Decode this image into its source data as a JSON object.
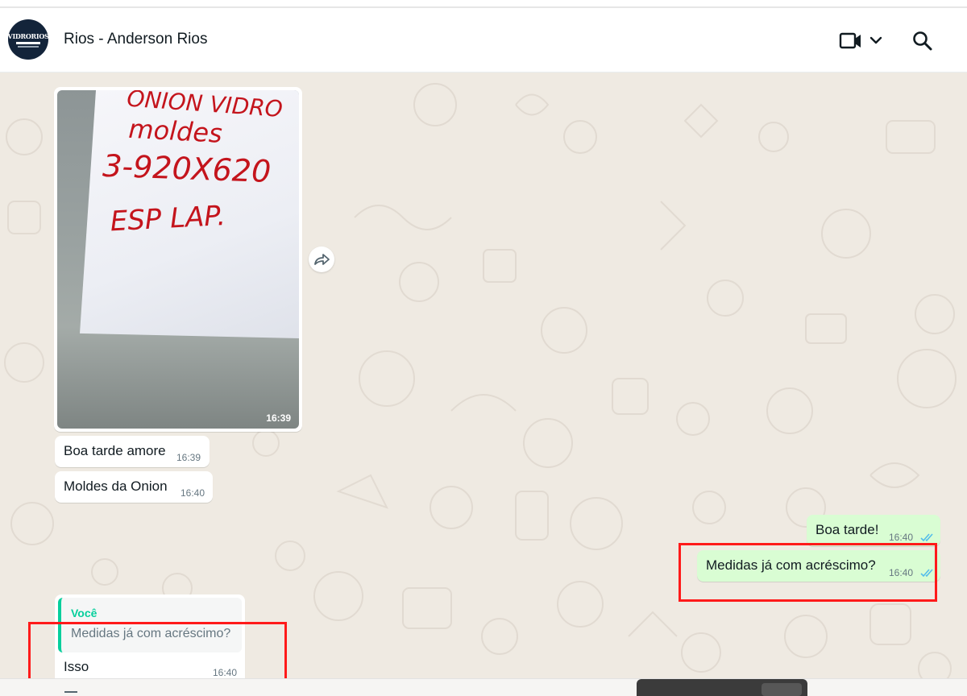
{
  "header": {
    "contact_name": "Rios - Anderson Rios",
    "avatar_text": "VIDRORIOS",
    "icons": [
      "video-call-icon",
      "chevron-down-icon",
      "search-icon"
    ]
  },
  "messages": {
    "image": {
      "time": "16:39",
      "handwriting": [
        "ONION VIDRO",
        "moldes",
        "3-920X620",
        "ESP LAP."
      ]
    },
    "incoming_1": {
      "text": "Boa tarde amore",
      "time": "16:39"
    },
    "incoming_2": {
      "text": "Moldes da Onion",
      "time": "16:40"
    },
    "outgoing_1": {
      "text": "Boa tarde!",
      "time": "16:40",
      "status": "read"
    },
    "outgoing_2": {
      "text": "Medidas já com acréscimo?",
      "time": "16:40",
      "status": "read"
    },
    "reply": {
      "quote_author": "Você",
      "quote_text": "Medidas já com acréscimo?",
      "text": "Isso",
      "time": "16:40"
    }
  },
  "colors": {
    "chat_background": "#efeae2",
    "incoming_bubble": "#ffffff",
    "outgoing_bubble": "#d9fdd3",
    "read_ticks": "#53bdeb",
    "quote_accent": "#06cf9c",
    "highlight_box": "#ff1a1a"
  }
}
